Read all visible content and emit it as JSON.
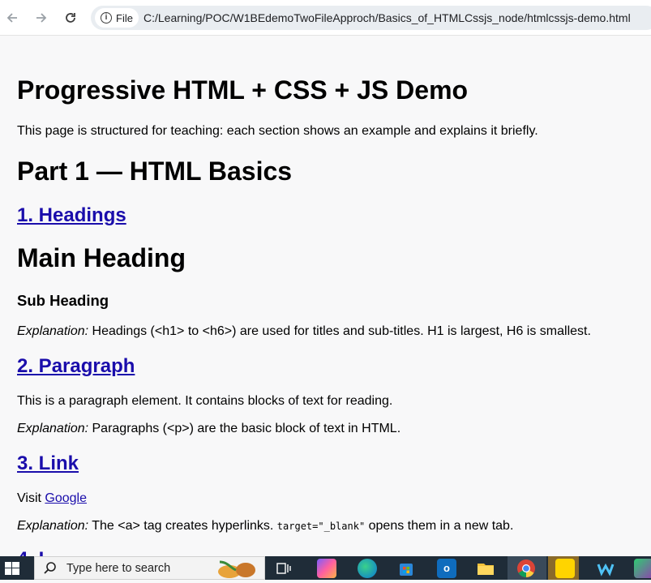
{
  "browser": {
    "file_label": "File",
    "url": "C:/Learning/POC/W1BEdemoTwoFileApproch/Basics_of_HTMLCssjs_node/htmlcssjs-demo.html",
    "icons": [
      "back-arrow-icon",
      "forward-arrow-icon",
      "reload-icon",
      "info-icon"
    ]
  },
  "page": {
    "title": "Progressive HTML + CSS + JS Demo",
    "intro": "This page is structured for teaching: each section shows an example and explains it briefly.",
    "part1_heading": "Part 1 — HTML Basics",
    "sections": {
      "headings": {
        "title": "1. Headings",
        "main_heading": "Main Heading",
        "sub_heading": "Sub Heading",
        "explanation_label": "Explanation:",
        "explanation_text": " Headings (<h1> to <h6>) are used for titles and sub-titles. H1 is largest, H6 is smallest."
      },
      "paragraph": {
        "title": "2. Paragraph",
        "example": "This is a paragraph element. It contains blocks of text for reading.",
        "explanation_label": "Explanation:",
        "explanation_text": " Paragraphs (<p>) are the basic block of text in HTML."
      },
      "link": {
        "title": "3. Link",
        "visit_prefix": "Visit ",
        "link_text": "Google",
        "explanation_label": "Explanation:",
        "explanation_text_1": " The <a> tag creates hyperlinks. ",
        "code_text": "target=\"_blank\"",
        "explanation_text_2": " opens them in a new tab."
      },
      "partial_next": "4. I"
    }
  },
  "taskbar": {
    "search_placeholder": "Type here to search",
    "icons": [
      "windows-start-icon",
      "search-icon",
      "task-view-icon",
      "copilot-icon",
      "edge-icon",
      "store-icon",
      "outlook-icon",
      "file-explorer-icon",
      "chrome-icon",
      "sticky-notes-icon",
      "webex-icon",
      "app-icon"
    ]
  },
  "colors": {
    "page_bg": "#f8f8f9",
    "link": "#1a0dab",
    "taskbar": "#1f2c38"
  }
}
